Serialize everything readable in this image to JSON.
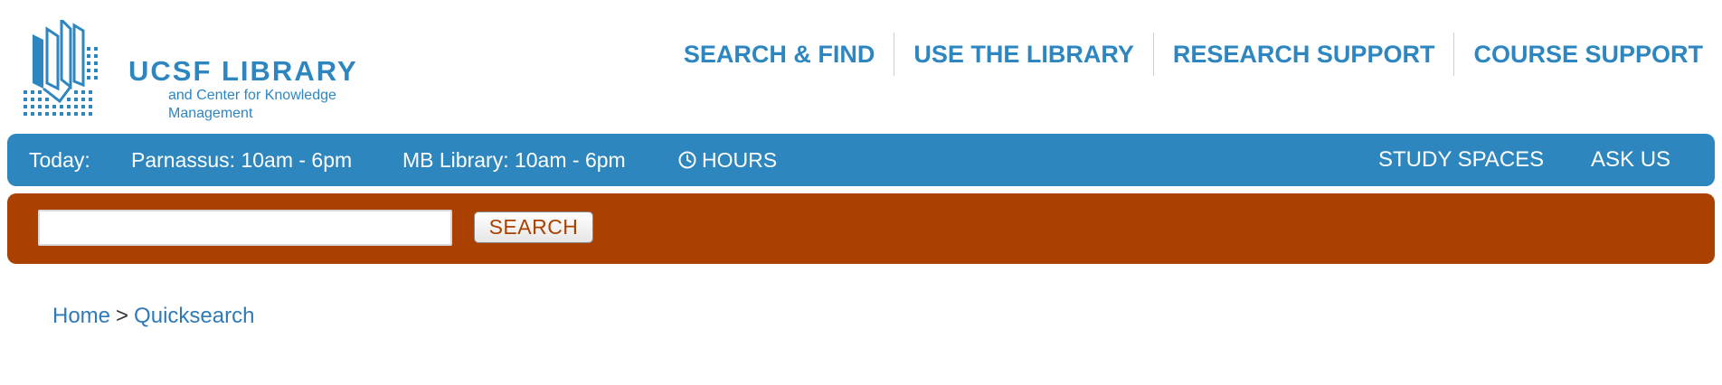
{
  "logo": {
    "title": "UCSF LIBRARY",
    "subtitle": "and Center for Knowledge Management",
    "icon": "library-books-logo-icon"
  },
  "main_nav": {
    "items": [
      {
        "label": "SEARCH & FIND"
      },
      {
        "label": "USE THE LIBRARY"
      },
      {
        "label": "RESEARCH SUPPORT"
      },
      {
        "label": "COURSE SUPPORT"
      }
    ]
  },
  "hours_bar": {
    "today_label": "Today:",
    "parnassus": "Parnassus: 10am - 6pm",
    "mb_library": "MB Library: 10am - 6pm",
    "hours_label": "HOURS",
    "hours_icon": "clock-icon",
    "study_spaces": "STUDY SPACES",
    "ask_us": "ASK US"
  },
  "search": {
    "input_value": "",
    "button_label": "SEARCH"
  },
  "breadcrumb": {
    "home": "Home",
    "separator": ">",
    "current": "Quicksearch"
  },
  "colors": {
    "brand_blue": "#2e86c1",
    "hours_bar_bg": "#2e86bf",
    "search_bar_bg": "#ab4100",
    "link_blue": "#2e7ab8"
  }
}
